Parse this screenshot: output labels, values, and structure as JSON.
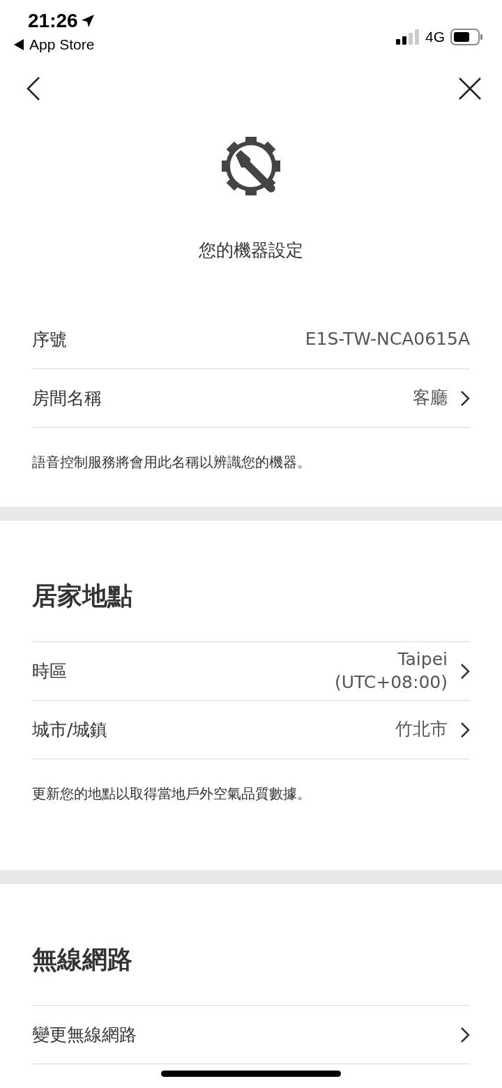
{
  "status_bar": {
    "time": "21:26",
    "back_app": "App Store",
    "network": "4G"
  },
  "header": {
    "title": "您的機器設定"
  },
  "sections": [
    {
      "rows": [
        {
          "label": "序號",
          "value_lines": [
            "E1S-TW-NCA0615A"
          ],
          "chevron": false
        },
        {
          "label": "房間名稱",
          "value_lines": [
            "客廳"
          ],
          "chevron": true
        }
      ],
      "note": "語音控制服務將會用此名稱以辨識您的機器。"
    },
    {
      "heading": "居家地點",
      "rows": [
        {
          "label": "時區",
          "value_lines": [
            "Taipei",
            "(UTC+08:00)"
          ],
          "chevron": true
        },
        {
          "label": "城市/城鎮",
          "value_lines": [
            "竹北市"
          ],
          "chevron": true
        }
      ],
      "note": "更新您的地點以取得當地戶外空氣品質數據。"
    },
    {
      "heading": "無線網路",
      "rows": [
        {
          "label": "變更無線網路",
          "chevron": true
        }
      ]
    }
  ]
}
